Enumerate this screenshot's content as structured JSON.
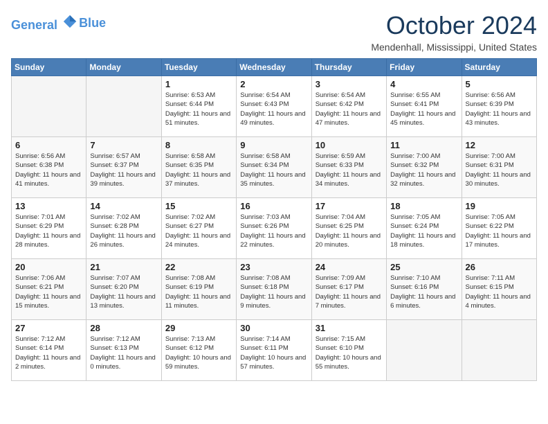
{
  "logo": {
    "line1": "General",
    "line2": "Blue"
  },
  "title": "October 2024",
  "location": "Mendenhall, Mississippi, United States",
  "days_header": [
    "Sunday",
    "Monday",
    "Tuesday",
    "Wednesday",
    "Thursday",
    "Friday",
    "Saturday"
  ],
  "weeks": [
    [
      {
        "day": "",
        "info": ""
      },
      {
        "day": "",
        "info": ""
      },
      {
        "day": "1",
        "info": "Sunrise: 6:53 AM\nSunset: 6:44 PM\nDaylight: 11 hours and 51 minutes."
      },
      {
        "day": "2",
        "info": "Sunrise: 6:54 AM\nSunset: 6:43 PM\nDaylight: 11 hours and 49 minutes."
      },
      {
        "day": "3",
        "info": "Sunrise: 6:54 AM\nSunset: 6:42 PM\nDaylight: 11 hours and 47 minutes."
      },
      {
        "day": "4",
        "info": "Sunrise: 6:55 AM\nSunset: 6:41 PM\nDaylight: 11 hours and 45 minutes."
      },
      {
        "day": "5",
        "info": "Sunrise: 6:56 AM\nSunset: 6:39 PM\nDaylight: 11 hours and 43 minutes."
      }
    ],
    [
      {
        "day": "6",
        "info": "Sunrise: 6:56 AM\nSunset: 6:38 PM\nDaylight: 11 hours and 41 minutes."
      },
      {
        "day": "7",
        "info": "Sunrise: 6:57 AM\nSunset: 6:37 PM\nDaylight: 11 hours and 39 minutes."
      },
      {
        "day": "8",
        "info": "Sunrise: 6:58 AM\nSunset: 6:35 PM\nDaylight: 11 hours and 37 minutes."
      },
      {
        "day": "9",
        "info": "Sunrise: 6:58 AM\nSunset: 6:34 PM\nDaylight: 11 hours and 35 minutes."
      },
      {
        "day": "10",
        "info": "Sunrise: 6:59 AM\nSunset: 6:33 PM\nDaylight: 11 hours and 34 minutes."
      },
      {
        "day": "11",
        "info": "Sunrise: 7:00 AM\nSunset: 6:32 PM\nDaylight: 11 hours and 32 minutes."
      },
      {
        "day": "12",
        "info": "Sunrise: 7:00 AM\nSunset: 6:31 PM\nDaylight: 11 hours and 30 minutes."
      }
    ],
    [
      {
        "day": "13",
        "info": "Sunrise: 7:01 AM\nSunset: 6:29 PM\nDaylight: 11 hours and 28 minutes."
      },
      {
        "day": "14",
        "info": "Sunrise: 7:02 AM\nSunset: 6:28 PM\nDaylight: 11 hours and 26 minutes."
      },
      {
        "day": "15",
        "info": "Sunrise: 7:02 AM\nSunset: 6:27 PM\nDaylight: 11 hours and 24 minutes."
      },
      {
        "day": "16",
        "info": "Sunrise: 7:03 AM\nSunset: 6:26 PM\nDaylight: 11 hours and 22 minutes."
      },
      {
        "day": "17",
        "info": "Sunrise: 7:04 AM\nSunset: 6:25 PM\nDaylight: 11 hours and 20 minutes."
      },
      {
        "day": "18",
        "info": "Sunrise: 7:05 AM\nSunset: 6:24 PM\nDaylight: 11 hours and 18 minutes."
      },
      {
        "day": "19",
        "info": "Sunrise: 7:05 AM\nSunset: 6:22 PM\nDaylight: 11 hours and 17 minutes."
      }
    ],
    [
      {
        "day": "20",
        "info": "Sunrise: 7:06 AM\nSunset: 6:21 PM\nDaylight: 11 hours and 15 minutes."
      },
      {
        "day": "21",
        "info": "Sunrise: 7:07 AM\nSunset: 6:20 PM\nDaylight: 11 hours and 13 minutes."
      },
      {
        "day": "22",
        "info": "Sunrise: 7:08 AM\nSunset: 6:19 PM\nDaylight: 11 hours and 11 minutes."
      },
      {
        "day": "23",
        "info": "Sunrise: 7:08 AM\nSunset: 6:18 PM\nDaylight: 11 hours and 9 minutes."
      },
      {
        "day": "24",
        "info": "Sunrise: 7:09 AM\nSunset: 6:17 PM\nDaylight: 11 hours and 7 minutes."
      },
      {
        "day": "25",
        "info": "Sunrise: 7:10 AM\nSunset: 6:16 PM\nDaylight: 11 hours and 6 minutes."
      },
      {
        "day": "26",
        "info": "Sunrise: 7:11 AM\nSunset: 6:15 PM\nDaylight: 11 hours and 4 minutes."
      }
    ],
    [
      {
        "day": "27",
        "info": "Sunrise: 7:12 AM\nSunset: 6:14 PM\nDaylight: 11 hours and 2 minutes."
      },
      {
        "day": "28",
        "info": "Sunrise: 7:12 AM\nSunset: 6:13 PM\nDaylight: 11 hours and 0 minutes."
      },
      {
        "day": "29",
        "info": "Sunrise: 7:13 AM\nSunset: 6:12 PM\nDaylight: 10 hours and 59 minutes."
      },
      {
        "day": "30",
        "info": "Sunrise: 7:14 AM\nSunset: 6:11 PM\nDaylight: 10 hours and 57 minutes."
      },
      {
        "day": "31",
        "info": "Sunrise: 7:15 AM\nSunset: 6:10 PM\nDaylight: 10 hours and 55 minutes."
      },
      {
        "day": "",
        "info": ""
      },
      {
        "day": "",
        "info": ""
      }
    ]
  ]
}
